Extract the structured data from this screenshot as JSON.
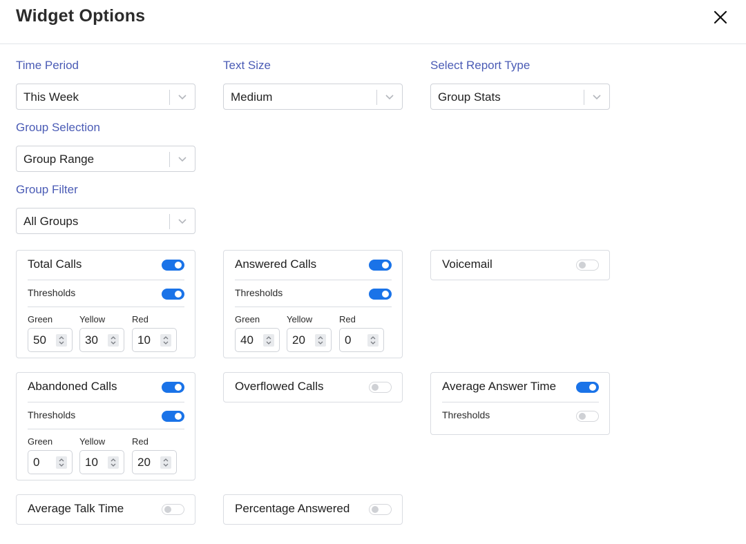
{
  "header": {
    "title": "Widget Options"
  },
  "fields": {
    "time_period": {
      "label": "Time Period",
      "value": "This Week"
    },
    "text_size": {
      "label": "Text Size",
      "value": "Medium"
    },
    "report_type": {
      "label": "Select Report Type",
      "value": "Group Stats"
    },
    "group_selection": {
      "label": "Group Selection",
      "value": "Group Range"
    },
    "group_filter": {
      "label": "Group Filter",
      "value": "All Groups"
    }
  },
  "threshold_labels": {
    "thresholds": "Thresholds",
    "green": "Green",
    "yellow": "Yellow",
    "red": "Red"
  },
  "cards": {
    "total_calls": {
      "title": "Total Calls",
      "enabled": true,
      "thresholds_enabled": true,
      "green": "50",
      "yellow": "30",
      "red": "10"
    },
    "answered_calls": {
      "title": "Answered Calls",
      "enabled": true,
      "thresholds_enabled": true,
      "green": "40",
      "yellow": "20",
      "red": "0"
    },
    "voicemail": {
      "title": "Voicemail",
      "enabled": false
    },
    "abandoned_calls": {
      "title": "Abandoned Calls",
      "enabled": true,
      "thresholds_enabled": true,
      "green": "0",
      "yellow": "10",
      "red": "20"
    },
    "overflowed_calls": {
      "title": "Overflowed Calls",
      "enabled": false
    },
    "average_answer_time": {
      "title": "Average Answer Time",
      "enabled": true,
      "thresholds_enabled": false
    },
    "average_talk_time": {
      "title": "Average Talk Time",
      "enabled": false
    },
    "percentage_answered": {
      "title": "Percentage Answered",
      "enabled": false
    }
  },
  "colors": {
    "accent": "#1a73e8",
    "label": "#4a5bb5",
    "toggle_off": "#cfd1d5"
  },
  "icons": {
    "close": "close-icon",
    "chevron": "chevron-down-icon",
    "spinner": "stepper-arrows-icon"
  }
}
